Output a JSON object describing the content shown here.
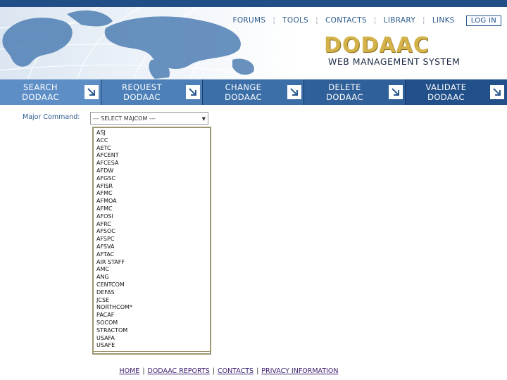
{
  "header": {
    "topnav": [
      "FORUMS",
      "TOOLS",
      "CONTACTS",
      "LIBRARY",
      "LINKS"
    ],
    "login_label": "LOG IN",
    "logo_text": "DODAAC",
    "subtitle": "WEB MANAGEMENT SYSTEM"
  },
  "nav": [
    {
      "line1": "SEARCH",
      "line2": "DODAAC"
    },
    {
      "line1": "REQUEST",
      "line2": "DODAAC"
    },
    {
      "line1": "CHANGE",
      "line2": "DODAAC"
    },
    {
      "line1": "DELETE",
      "line2": "DODAAC"
    },
    {
      "line1": "VALIDATE",
      "line2": "DODAAC"
    }
  ],
  "form": {
    "label": "Major Command:",
    "select_value": "--- SELECT MAJCOM ---",
    "options": [
      "ASJ",
      "ACC",
      "AETC",
      "AFCENT",
      "AFCESA",
      "AFDW",
      "AFGSC",
      "AFISR",
      "AFMC",
      "AFMOA",
      "AFMC",
      "AFOSI",
      "AFRC",
      "AFSOC",
      "AFSPC",
      "AFSVA",
      "AFTAC",
      "AIR STAFF",
      "AMC",
      "ANG",
      "CENTCOM",
      "DEFAS",
      "JCSE",
      "NORTHCOM*",
      "PACAF",
      "SOCOM",
      "STRACTOM",
      "USAFA",
      "USAFE"
    ]
  },
  "footer": {
    "links": [
      "HOME",
      "DODAAC REPORTS",
      "CONTACTS",
      "PRIVACY INFORMATION"
    ]
  }
}
